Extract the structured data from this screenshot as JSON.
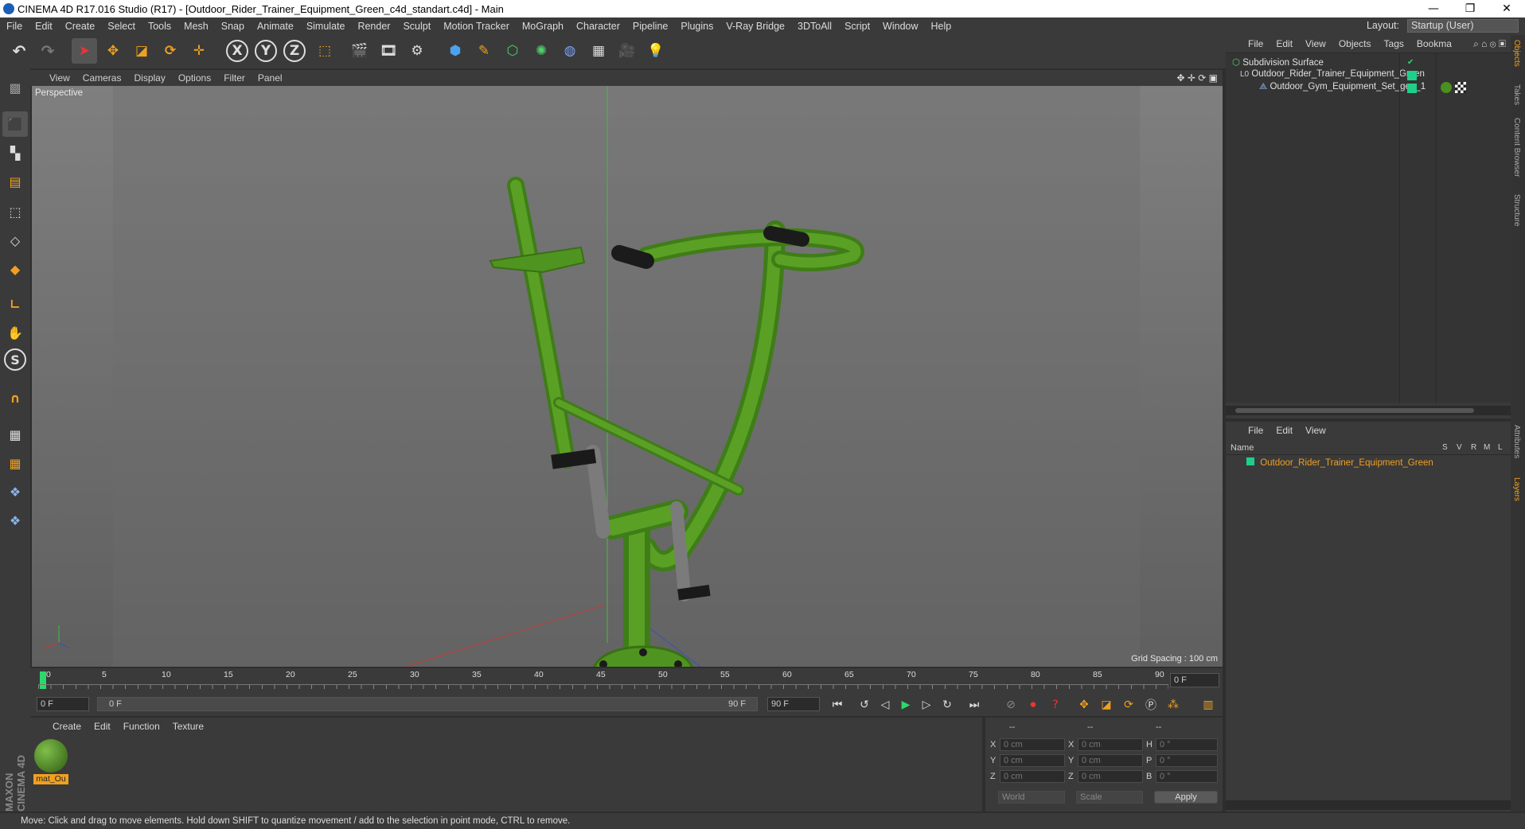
{
  "window": {
    "title": "CINEMA 4D R17.016 Studio (R17) - [Outdoor_Rider_Trainer_Equipment_Green_c4d_standart.c4d] - Main",
    "minimize": "—",
    "restore": "❐",
    "close": "✕"
  },
  "menubar": {
    "items": [
      "File",
      "Edit",
      "Create",
      "Select",
      "Tools",
      "Mesh",
      "Snap",
      "Animate",
      "Simulate",
      "Render",
      "Sculpt",
      "Motion Tracker",
      "MoGraph",
      "Character",
      "Pipeline",
      "Plugins",
      "V-Ray Bridge",
      "3DToAll",
      "Script",
      "Window",
      "Help"
    ],
    "layout_label": "Layout:",
    "layout_value": "Startup (User)"
  },
  "toolbar": {
    "axis_x": "X",
    "axis_y": "Y",
    "axis_z": "Z"
  },
  "viewport": {
    "menu": [
      "View",
      "Cameras",
      "Display",
      "Options",
      "Filter",
      "Panel"
    ],
    "label": "Perspective",
    "grid_spacing": "Grid Spacing : 100 cm"
  },
  "timeline": {
    "ticks": [
      "0",
      "5",
      "10",
      "15",
      "20",
      "25",
      "30",
      "35",
      "40",
      "45",
      "50",
      "55",
      "60",
      "65",
      "70",
      "75",
      "80",
      "85",
      "90"
    ],
    "current_frame": "0 F"
  },
  "transport": {
    "start_field": "0 F",
    "range_start": "0 F",
    "range_end": "90 F",
    "end_field": "90 F"
  },
  "material_manager": {
    "menu": [
      "Create",
      "Edit",
      "Function",
      "Texture"
    ],
    "material_name": "mat_Ou"
  },
  "coordinates": {
    "header_a": "--",
    "header_b": "--",
    "header_c": "--",
    "labels_pos": [
      "X",
      "Y",
      "Z"
    ],
    "labels_size": [
      "X",
      "Y",
      "Z"
    ],
    "labels_rot": [
      "H",
      "P",
      "B"
    ],
    "pos": [
      "0 cm",
      "0 cm",
      "0 cm"
    ],
    "size": [
      "0 cm",
      "0 cm",
      "0 cm"
    ],
    "rot": [
      "0 °",
      "0 °",
      "0 °"
    ],
    "mode_world": "World",
    "mode_scale": "Scale",
    "apply": "Apply"
  },
  "object_manager": {
    "menu": [
      "File",
      "Edit",
      "View",
      "Objects",
      "Tags",
      "Bookma"
    ],
    "objects": [
      "Subdivision Surface",
      "Outdoor_Rider_Trainer_Equipment_Green",
      "Outdoor_Gym_Equipment_Set_geo_1"
    ],
    "tag_lo": "L0"
  },
  "layer_manager": {
    "menu": [
      "File",
      "Edit",
      "View"
    ],
    "col_name": "Name",
    "col_flags": [
      "S",
      "V",
      "R",
      "M",
      "L"
    ],
    "layer": "Outdoor_Rider_Trainer_Equipment_Green"
  },
  "side_tabs": [
    "Objects",
    "Takes",
    "Content Browser",
    "Structure",
    "Attributes",
    "Layers"
  ],
  "status": "Move: Click and drag to move elements. Hold down SHIFT to quantize movement / add to the selection in point mode, CTRL to remove.",
  "brand": "MAXON CINEMA 4D",
  "colors": {
    "accent": "#f0a020",
    "green_layer": "#1ecf8a",
    "model_green": "#4a8f1f"
  }
}
